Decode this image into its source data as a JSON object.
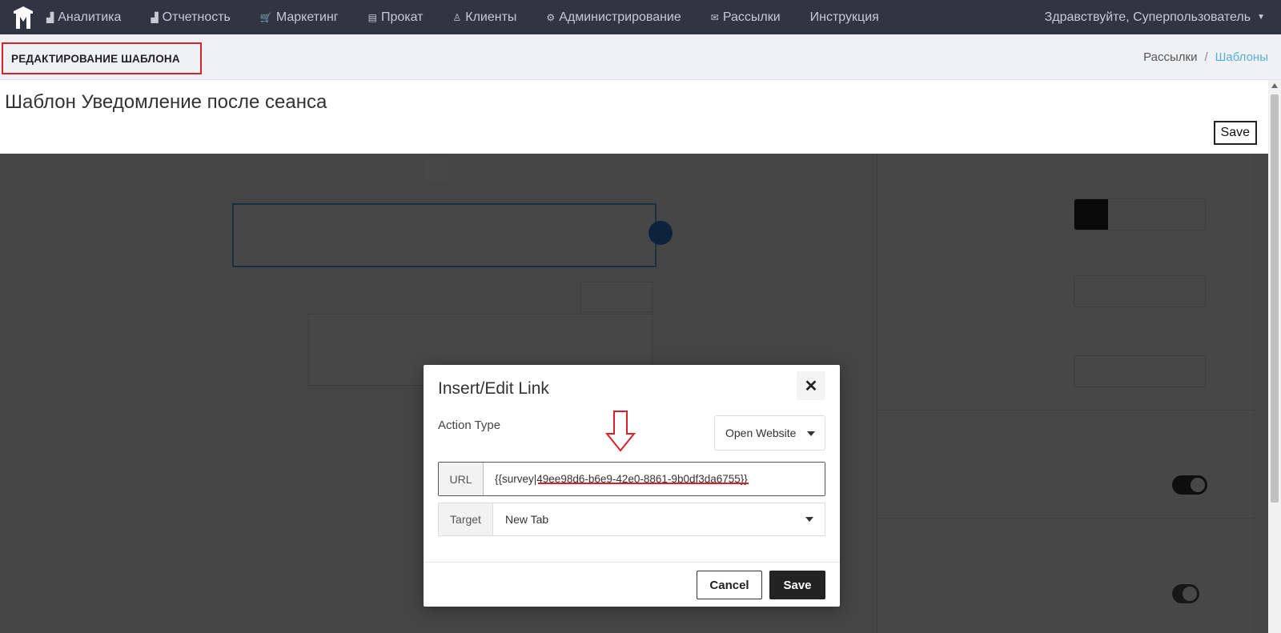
{
  "nav": {
    "items": [
      {
        "icon": "bar-chart-icon",
        "glyph": "▟",
        "label": "Аналитика"
      },
      {
        "icon": "bar-chart-icon",
        "glyph": "▟",
        "label": "Отчетность"
      },
      {
        "icon": "cart-icon",
        "glyph": "🛒",
        "label": "Маркетинг"
      },
      {
        "icon": "film-icon",
        "glyph": "▤",
        "label": "Прокат"
      },
      {
        "icon": "user-icon",
        "glyph": "♙",
        "label": "Клиенты"
      },
      {
        "icon": "gear-icon",
        "glyph": "⚙",
        "label": "Администрирование"
      },
      {
        "icon": "mail-icon",
        "glyph": "✉",
        "label": "Рассылки"
      },
      {
        "icon": "",
        "glyph": "",
        "label": "Инструкция"
      }
    ],
    "greeting": "Здравствуйте, Суперпользователь"
  },
  "page": {
    "title": "РЕДАКТИРОВАНИЕ ШАБЛОНА",
    "breadcrumb": [
      "Рассылки",
      "Шаблоны"
    ]
  },
  "template": {
    "title": "Шаблон Уведомление после сеанса",
    "save_label": "Save"
  },
  "modal": {
    "title": "Insert/Edit Link",
    "action_type_label": "Action Type",
    "action_type_value": "Open Website",
    "url_label": "URL",
    "url_value": "{{survey|49ee98d6-b6e9-42e0-8861-9b0df3da6755}}",
    "target_label": "Target",
    "target_value": "New Tab",
    "cancel_label": "Cancel",
    "save_label": "Save"
  },
  "colors": {
    "navbar": "#2f3542",
    "annotation_red": "#d8222a",
    "breadcrumb_active": "#5aaed9"
  }
}
